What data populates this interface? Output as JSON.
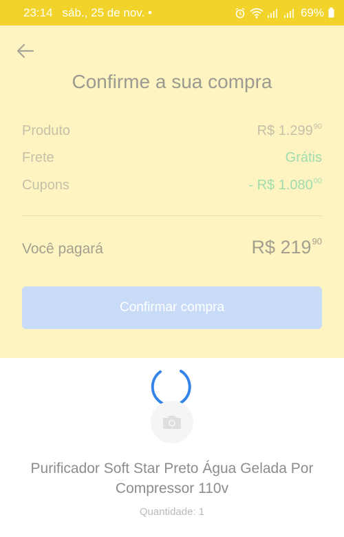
{
  "status_bar": {
    "time": "23:14",
    "date": "sáb., 25 de nov. •",
    "battery": "69%"
  },
  "header": {
    "title": "Confirme a sua compra"
  },
  "summary": {
    "product": {
      "label": "Produto",
      "value": "R$ 1.299",
      "cents": "90"
    },
    "shipping": {
      "label": "Frete",
      "value": "Grátis"
    },
    "coupons": {
      "label": "Cupons",
      "value": "- R$ 1.080",
      "cents": "00"
    },
    "total": {
      "label": "Você pagará",
      "value": "R$ 219",
      "cents": "90"
    }
  },
  "actions": {
    "confirm_label": "Confirmar compra"
  },
  "product": {
    "name": "Purificador Soft Star Preto Água Gelada Por Compressor 110v",
    "quantity": "Quantidade: 1"
  },
  "colors": {
    "status_bar": "#f2d32b",
    "sheet": "#fdf4c2",
    "free_shipping": "#9fdcae",
    "confirm_button": "#c8dcf8",
    "spinner": "#3483e8"
  },
  "icons": [
    "back-arrow-icon",
    "alarm-icon",
    "wifi-icon",
    "signal-icon",
    "battery-icon",
    "camera-icon",
    "loading-spinner-icon"
  ]
}
